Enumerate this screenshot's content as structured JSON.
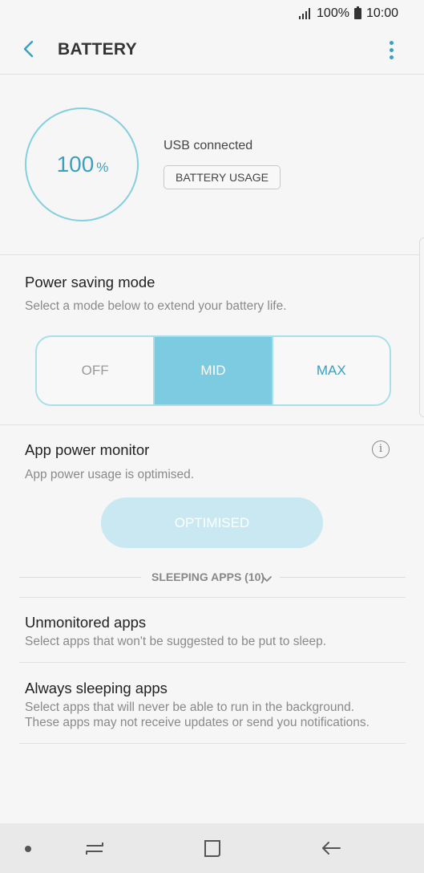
{
  "status_bar": {
    "battery_percent": "100%",
    "time": "10:00",
    "signal_icon": "signal-icon",
    "battery_icon": "battery-icon"
  },
  "header": {
    "title": "BATTERY",
    "back_icon": "back-arrow-icon",
    "more_icon": "more-options-icon"
  },
  "battery": {
    "percent_value": "100",
    "percent_unit": "%",
    "status": "USB connected",
    "usage_button": "BATTERY USAGE",
    "ring_color": "#84cfe0"
  },
  "power_saving": {
    "title": "Power saving mode",
    "subtitle": "Select a mode below to extend your battery life.",
    "modes": [
      "OFF",
      "MID",
      "MAX"
    ],
    "selected": "MID",
    "accent": "#7dcbe1"
  },
  "app_power_monitor": {
    "title": "App power monitor",
    "subtitle": "App power usage is optimised.",
    "button": "OPTIMISED",
    "info_icon": "info-icon"
  },
  "sleeping_apps": {
    "label": "SLEEPING APPS (10)",
    "chevron_icon": "chevron-down-icon"
  },
  "list": [
    {
      "title": "Unmonitored apps",
      "subtitle": "Select apps that won't be suggested to be put to sleep."
    },
    {
      "title": "Always sleeping apps",
      "subtitle_1": "Select apps that will never be able to run in the background.",
      "subtitle_2": "These apps may not receive updates or send you notifications."
    }
  ],
  "nav_bar": {
    "icons": [
      "nav-dot-icon",
      "recent-apps-icon",
      "home-icon",
      "back-icon"
    ]
  }
}
